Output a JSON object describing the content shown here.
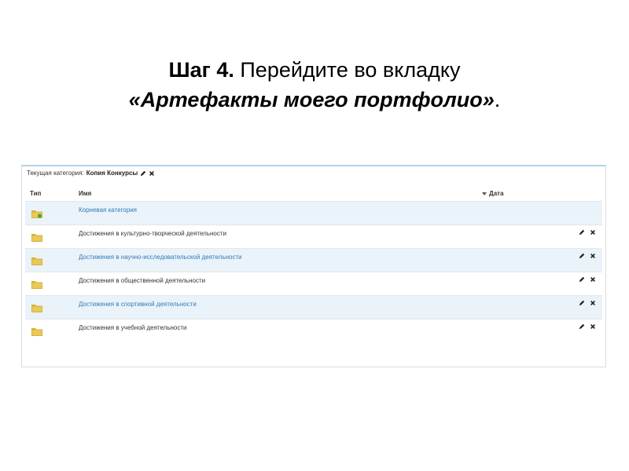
{
  "slide": {
    "step_label": "Шаг 4.",
    "instruction": " Перейдите во вкладку ",
    "target_tab": "«Артефакты моего портфолио»",
    "end": "."
  },
  "panel": {
    "current_category_label": "Текущая категория:",
    "current_category_name": "Копия Конкурсы",
    "columns": {
      "type": "Тип",
      "name": "Имя",
      "date": "Дата"
    },
    "rows": [
      {
        "name": "Корневая категория",
        "icon": "root-folder-icon"
      },
      {
        "name": "Достижения в культурно-творческой деятельности",
        "icon": "folder-icon"
      },
      {
        "name": "Достижения в научно-исследовательской деятельности",
        "icon": "folder-icon"
      },
      {
        "name": "Достижения в общественной деятельности",
        "icon": "folder-icon"
      },
      {
        "name": "Достижения в спортивной деятельности",
        "icon": "folder-icon"
      },
      {
        "name": "Достижения в учебной деятельности",
        "icon": "folder-icon"
      }
    ]
  },
  "colors": {
    "link": "#2f7bb6",
    "row_alt": "#eaf3fa",
    "folder": "#d8b13a"
  }
}
